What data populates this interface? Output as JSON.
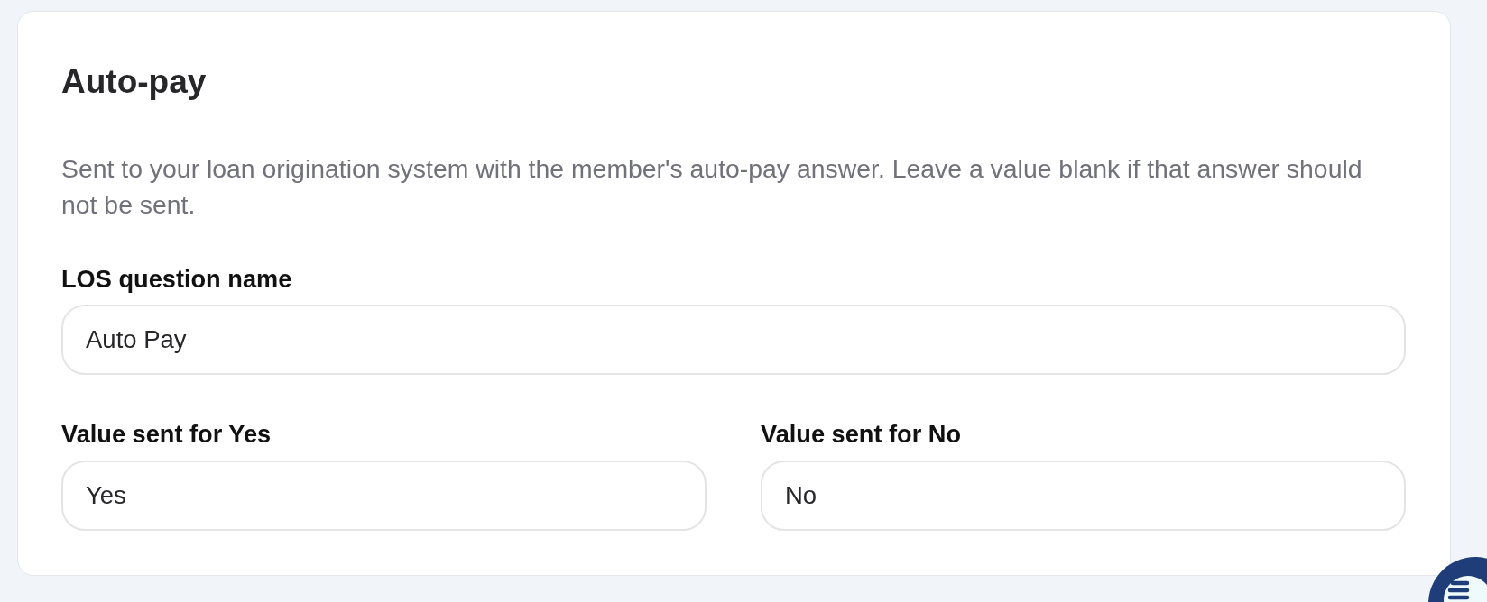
{
  "card": {
    "title": "Auto-pay",
    "description": "Sent to your loan origination system with the member's auto-pay answer. Leave a value blank if that answer should not be sent.",
    "question_field": {
      "label": "LOS question name",
      "value": "Auto Pay"
    },
    "answer_fields": [
      {
        "label": "Value sent for Yes",
        "value": "Yes"
      },
      {
        "label": "Value sent for No",
        "value": "No"
      }
    ]
  }
}
